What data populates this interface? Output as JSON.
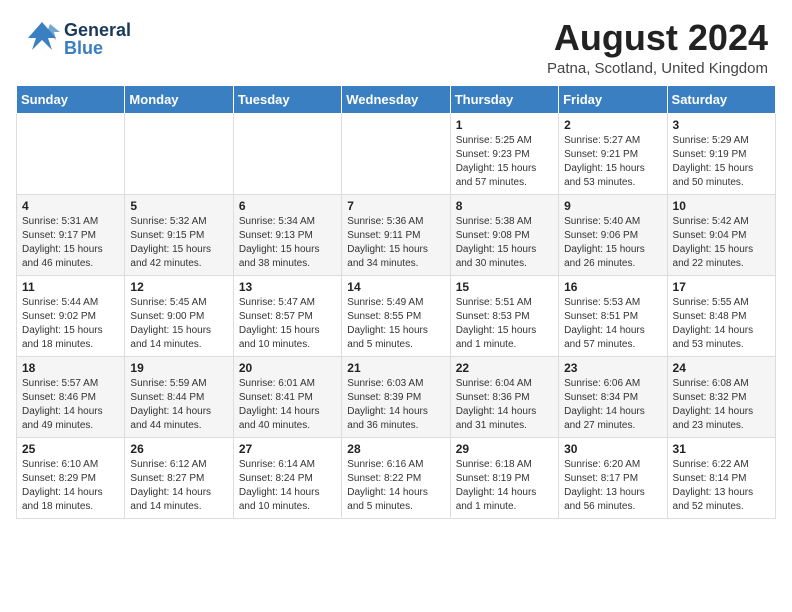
{
  "header": {
    "logo_general": "General",
    "logo_blue": "Blue",
    "title": "August 2024",
    "location": "Patna, Scotland, United Kingdom"
  },
  "days_of_week": [
    "Sunday",
    "Monday",
    "Tuesday",
    "Wednesday",
    "Thursday",
    "Friday",
    "Saturday"
  ],
  "weeks": [
    [
      {
        "day": "",
        "info": ""
      },
      {
        "day": "",
        "info": ""
      },
      {
        "day": "",
        "info": ""
      },
      {
        "day": "",
        "info": ""
      },
      {
        "day": "1",
        "info": "Sunrise: 5:25 AM\nSunset: 9:23 PM\nDaylight: 15 hours\nand 57 minutes."
      },
      {
        "day": "2",
        "info": "Sunrise: 5:27 AM\nSunset: 9:21 PM\nDaylight: 15 hours\nand 53 minutes."
      },
      {
        "day": "3",
        "info": "Sunrise: 5:29 AM\nSunset: 9:19 PM\nDaylight: 15 hours\nand 50 minutes."
      }
    ],
    [
      {
        "day": "4",
        "info": "Sunrise: 5:31 AM\nSunset: 9:17 PM\nDaylight: 15 hours\nand 46 minutes."
      },
      {
        "day": "5",
        "info": "Sunrise: 5:32 AM\nSunset: 9:15 PM\nDaylight: 15 hours\nand 42 minutes."
      },
      {
        "day": "6",
        "info": "Sunrise: 5:34 AM\nSunset: 9:13 PM\nDaylight: 15 hours\nand 38 minutes."
      },
      {
        "day": "7",
        "info": "Sunrise: 5:36 AM\nSunset: 9:11 PM\nDaylight: 15 hours\nand 34 minutes."
      },
      {
        "day": "8",
        "info": "Sunrise: 5:38 AM\nSunset: 9:08 PM\nDaylight: 15 hours\nand 30 minutes."
      },
      {
        "day": "9",
        "info": "Sunrise: 5:40 AM\nSunset: 9:06 PM\nDaylight: 15 hours\nand 26 minutes."
      },
      {
        "day": "10",
        "info": "Sunrise: 5:42 AM\nSunset: 9:04 PM\nDaylight: 15 hours\nand 22 minutes."
      }
    ],
    [
      {
        "day": "11",
        "info": "Sunrise: 5:44 AM\nSunset: 9:02 PM\nDaylight: 15 hours\nand 18 minutes."
      },
      {
        "day": "12",
        "info": "Sunrise: 5:45 AM\nSunset: 9:00 PM\nDaylight: 15 hours\nand 14 minutes."
      },
      {
        "day": "13",
        "info": "Sunrise: 5:47 AM\nSunset: 8:57 PM\nDaylight: 15 hours\nand 10 minutes."
      },
      {
        "day": "14",
        "info": "Sunrise: 5:49 AM\nSunset: 8:55 PM\nDaylight: 15 hours\nand 5 minutes."
      },
      {
        "day": "15",
        "info": "Sunrise: 5:51 AM\nSunset: 8:53 PM\nDaylight: 15 hours\nand 1 minute."
      },
      {
        "day": "16",
        "info": "Sunrise: 5:53 AM\nSunset: 8:51 PM\nDaylight: 14 hours\nand 57 minutes."
      },
      {
        "day": "17",
        "info": "Sunrise: 5:55 AM\nSunset: 8:48 PM\nDaylight: 14 hours\nand 53 minutes."
      }
    ],
    [
      {
        "day": "18",
        "info": "Sunrise: 5:57 AM\nSunset: 8:46 PM\nDaylight: 14 hours\nand 49 minutes."
      },
      {
        "day": "19",
        "info": "Sunrise: 5:59 AM\nSunset: 8:44 PM\nDaylight: 14 hours\nand 44 minutes."
      },
      {
        "day": "20",
        "info": "Sunrise: 6:01 AM\nSunset: 8:41 PM\nDaylight: 14 hours\nand 40 minutes."
      },
      {
        "day": "21",
        "info": "Sunrise: 6:03 AM\nSunset: 8:39 PM\nDaylight: 14 hours\nand 36 minutes."
      },
      {
        "day": "22",
        "info": "Sunrise: 6:04 AM\nSunset: 8:36 PM\nDaylight: 14 hours\nand 31 minutes."
      },
      {
        "day": "23",
        "info": "Sunrise: 6:06 AM\nSunset: 8:34 PM\nDaylight: 14 hours\nand 27 minutes."
      },
      {
        "day": "24",
        "info": "Sunrise: 6:08 AM\nSunset: 8:32 PM\nDaylight: 14 hours\nand 23 minutes."
      }
    ],
    [
      {
        "day": "25",
        "info": "Sunrise: 6:10 AM\nSunset: 8:29 PM\nDaylight: 14 hours\nand 18 minutes."
      },
      {
        "day": "26",
        "info": "Sunrise: 6:12 AM\nSunset: 8:27 PM\nDaylight: 14 hours\nand 14 minutes."
      },
      {
        "day": "27",
        "info": "Sunrise: 6:14 AM\nSunset: 8:24 PM\nDaylight: 14 hours\nand 10 minutes."
      },
      {
        "day": "28",
        "info": "Sunrise: 6:16 AM\nSunset: 8:22 PM\nDaylight: 14 hours\nand 5 minutes."
      },
      {
        "day": "29",
        "info": "Sunrise: 6:18 AM\nSunset: 8:19 PM\nDaylight: 14 hours\nand 1 minute."
      },
      {
        "day": "30",
        "info": "Sunrise: 6:20 AM\nSunset: 8:17 PM\nDaylight: 13 hours\nand 56 minutes."
      },
      {
        "day": "31",
        "info": "Sunrise: 6:22 AM\nSunset: 8:14 PM\nDaylight: 13 hours\nand 52 minutes."
      }
    ]
  ]
}
